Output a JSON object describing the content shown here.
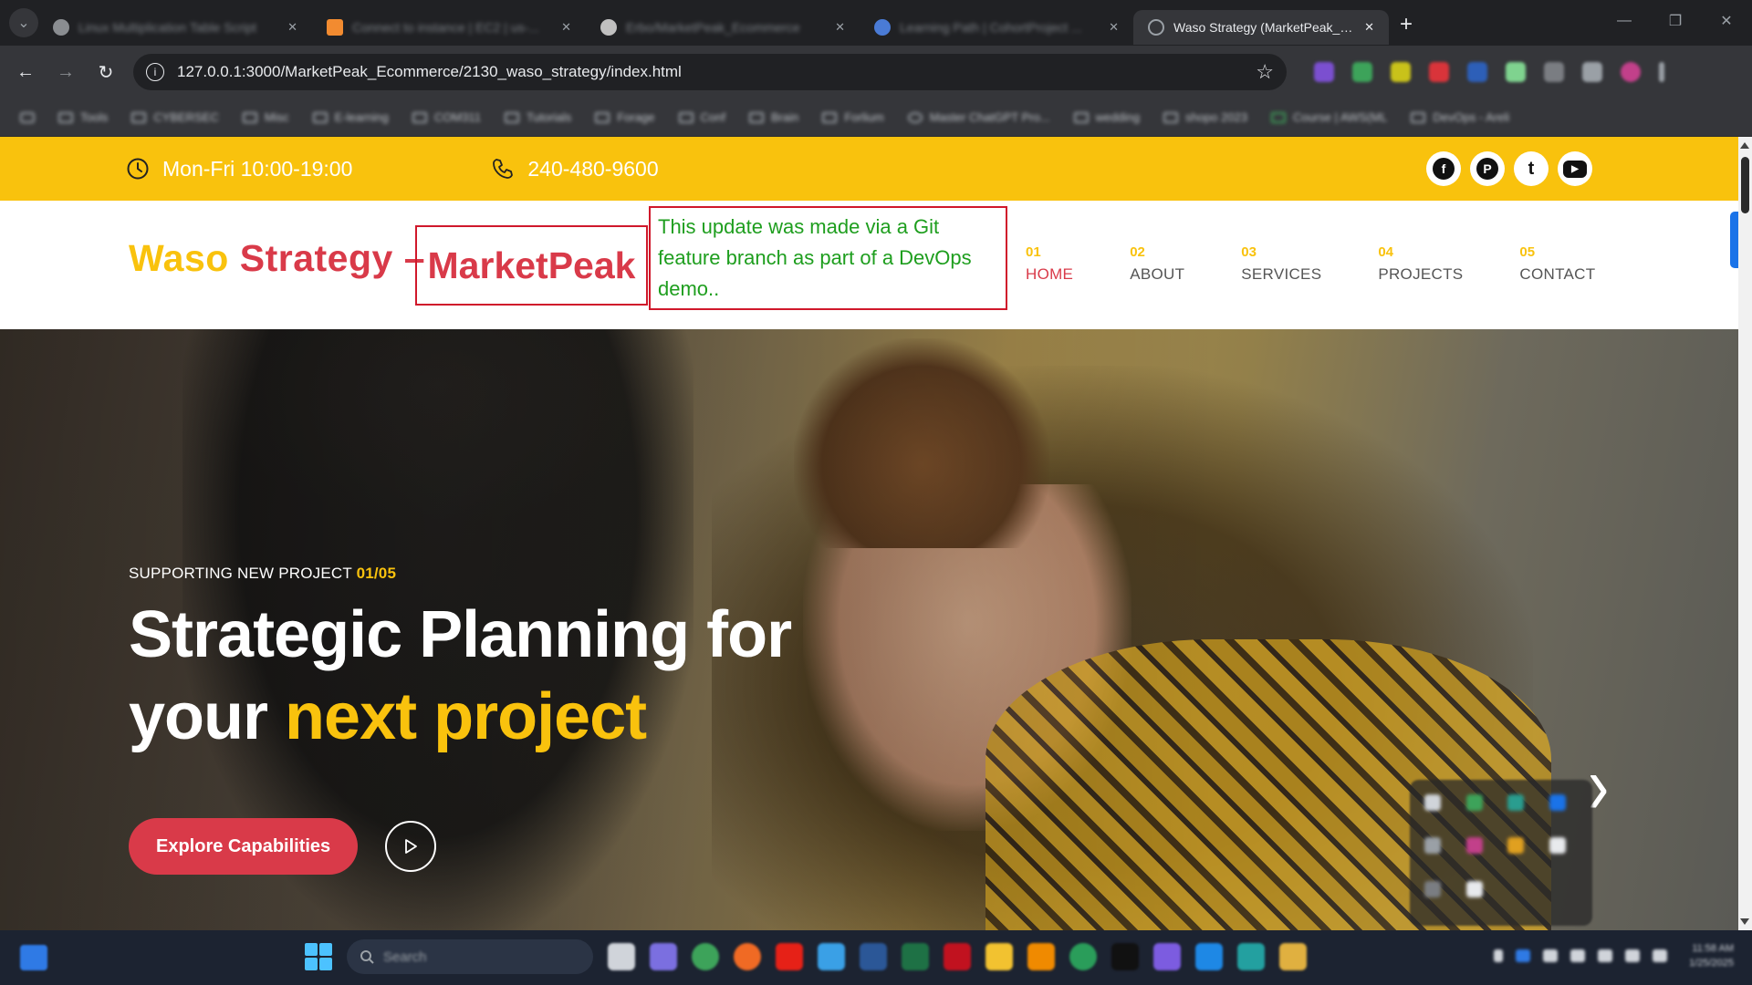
{
  "browser": {
    "tabs": [
      {
        "title": "Linux Multiplication Table Script",
        "favicon_color": "#8a8d91"
      },
      {
        "title": "Connect to instance | EC2 | us-...",
        "favicon_color": "#f28b30"
      },
      {
        "title": "Erbo/MarketPeak_Ecommerce",
        "favicon_color": "#c0c0c0"
      },
      {
        "title": "Learning Path | CohortProject ...",
        "favicon_color": "#4a7bd6"
      },
      {
        "title": "Waso Strategy (MarketPeak_Eco",
        "favicon_color": "#9aa0a6",
        "active": true
      }
    ],
    "new_tab_symbol": "+",
    "url": "127.0.0.1:3000/MarketPeak_Ecommerce/2130_waso_strategy/index.html",
    "bookmarks": [
      "Tools",
      "CYBERSEC",
      "Misc",
      "E-learning",
      "COM311",
      "Tutorials",
      "Forage",
      "Conf",
      "Brain",
      "Forlium",
      "Master ChatGPT Pro...",
      "wedding",
      "shopo 2023",
      "Course | AWS(ML",
      "DevOps - Areli"
    ]
  },
  "site": {
    "topbar": {
      "hours": "Mon-Fri 10:00-19:00",
      "phone": "240-480-9600",
      "socials": [
        {
          "name": "facebook",
          "glyph": "f"
        },
        {
          "name": "pinterest",
          "glyph": "P"
        },
        {
          "name": "twitter",
          "glyph": "t"
        },
        {
          "name": "youtube",
          "glyph": "▶"
        }
      ]
    },
    "brand": {
      "word1": "Waso",
      "word2": "Strategy",
      "dash": "–",
      "highlight": "MarketPeak"
    },
    "note": "This update was made via a Git feature branch as part of a DevOps demo..",
    "menu": [
      {
        "num": "01",
        "label": "HOME",
        "active": true
      },
      {
        "num": "02",
        "label": "ABOUT"
      },
      {
        "num": "03",
        "label": "SERVICES"
      },
      {
        "num": "04",
        "label": "PROJECTS"
      },
      {
        "num": "05",
        "label": "CONTACT"
      }
    ],
    "hero": {
      "kicker": "SUPPORTING NEW PROJECT",
      "kicker_count": "01/05",
      "headline_line1": "Strategic Planning for",
      "headline_word": "your",
      "headline_highlight": "next project",
      "cta_label": "Explore Capabilities",
      "next_arrow": "›"
    }
  },
  "taskbar": {
    "search_placeholder": "Search",
    "clock_time": "11:58 AM",
    "clock_date": "1/25/2025"
  },
  "colors": {
    "accent_yellow": "#f9c20d",
    "accent_red": "#d93a49",
    "note_green": "#1e9e1e",
    "box_border": "#d0182b"
  }
}
